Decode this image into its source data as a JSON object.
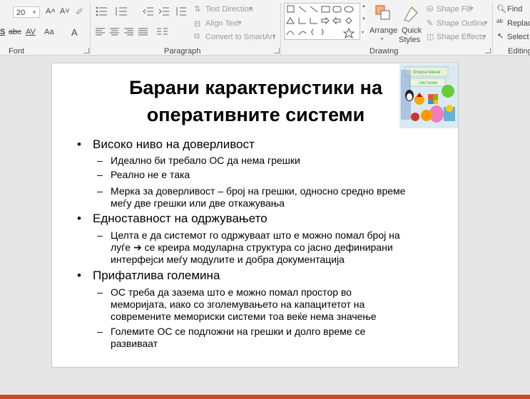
{
  "ribbon": {
    "font": {
      "size": "20",
      "grow_icon": "A˄",
      "shrink_icon": "A˅",
      "strike_label": "abc",
      "spacing_label": "AV",
      "case_label": "Aa",
      "color_label": "A",
      "shadow_label": "S",
      "group_label": "Font"
    },
    "paragraph": {
      "text_direction": "Text Direction",
      "align_text": "Align Text",
      "convert_smartart": "Convert to SmartArt",
      "group_label": "Paragraph"
    },
    "drawing": {
      "arrange": "Arrange",
      "quick_styles_1": "Quick",
      "quick_styles_2": "Styles",
      "shape_fill": "Shape Fill",
      "shape_outline": "Shape Outline",
      "shape_effects": "Shape Effects",
      "group_label": "Drawing"
    },
    "editing": {
      "find": "Find",
      "replace": "Replace",
      "select": "Select",
      "group_label": "Editing"
    }
  },
  "slide": {
    "title_line1": "Барани карактеристики на",
    "title_line2": "оперативните системи",
    "logo": {
      "line1": "Оперативни",
      "line2": "системи"
    },
    "bullets": [
      {
        "text": "Високо ниво на доверливост",
        "subs": [
          [
            "Идеално би требало ОС да нема грешки"
          ],
          [
            "Реално не е така"
          ],
          [
            "Мерка за доверливост – број на грешки, односно средно време",
            "меѓу две грешки или две откажувања"
          ]
        ]
      },
      {
        "text": "Едноставност на одржувањето",
        "subs": [
          [
            "Целта е да системот го одржуваат што е можно помал број на",
            "луѓе ➔ се креира модуларна структура со јасно дефинирани",
            "интерфејси меѓу модулите и добра документација"
          ]
        ]
      },
      {
        "text": "Прифатлива големина",
        "subs": [
          [
            "ОС треба да зазема што е можно помал простор во",
            "меморијата, иако со зголемувањето на капацитетот на",
            "современите мемориски системи тоа веќе нема значење"
          ],
          [
            "Големите ОС се подложни на грешки и долго време се",
            "развиваат"
          ]
        ]
      }
    ]
  }
}
